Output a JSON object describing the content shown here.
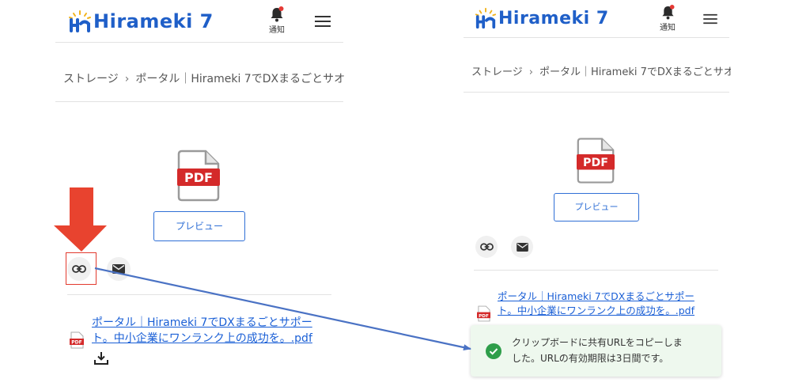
{
  "app": {
    "logo_text": "Hirameki 7",
    "notification_label": "通知"
  },
  "breadcrumb": {
    "items": [
      "ストレージ",
      "ポータル｜Hirameki 7でDXまるごとサオ"
    ],
    "separator": "›"
  },
  "file": {
    "icon_label": "PDF",
    "preview_button": "プレビュー",
    "name_line1": "ポータル｜Hirameki 7でDXまるごとサポー",
    "name_line2": "ト。中小企業にワンランク上の成功を。.pdf"
  },
  "icons": {
    "bell": "bell-icon",
    "menu": "hamburger-menu-icon",
    "link": "link-icon",
    "mail": "mail-icon",
    "download": "download-icon",
    "success": "check-circle-icon"
  },
  "toast": {
    "line1": "クリップボードに共有URLをコピーしま",
    "line2": "した。URLの有効期限は3日間です。"
  },
  "colors": {
    "brand": "#1f5fc8",
    "link": "#1a5fd6",
    "pdf_red": "#d42a2a",
    "annotation_red": "#e8432f",
    "annotation_arrow": "#4a72c4",
    "toast_bg": "#eef8ee",
    "success_green": "#2e9e4a"
  }
}
